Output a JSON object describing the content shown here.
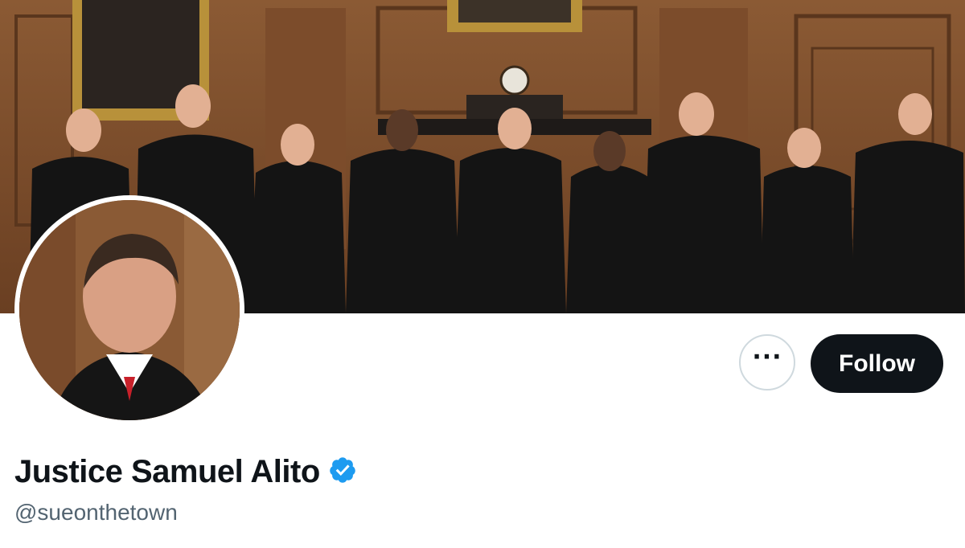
{
  "profile": {
    "display_name": "Justice Samuel Alito",
    "handle": "@sueonthetown",
    "verified": true,
    "verified_color": "#1d9bf0"
  },
  "actions": {
    "more_label": "···",
    "follow_label": "Follow"
  },
  "colors": {
    "follow_bg": "#0f1419",
    "handle_text": "#536471",
    "border": "#cfd9de"
  }
}
